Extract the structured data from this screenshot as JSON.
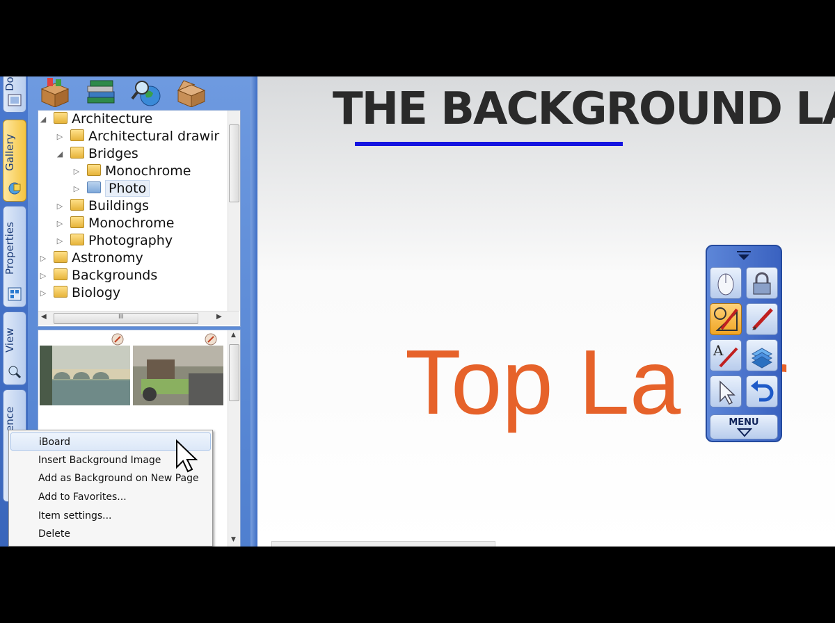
{
  "gallery": {
    "tabs": [
      {
        "label": "Gallery",
        "active": true
      },
      {
        "label": "Properties",
        "active": false
      },
      {
        "label": "View",
        "active": false
      },
      {
        "label": "ence",
        "active": false
      }
    ],
    "top_tab_partial": "Do",
    "toolbar_icons": [
      "open-box-icon",
      "books-icon",
      "globe-search-icon",
      "cardboard-box-icon"
    ],
    "tree": [
      {
        "label": "Architecture",
        "level": 0,
        "expanded": true
      },
      {
        "label": "Architectural drawir",
        "level": 1,
        "expanded": false
      },
      {
        "label": "Bridges",
        "level": 1,
        "expanded": true
      },
      {
        "label": "Monochrome",
        "level": 2,
        "expanded": false
      },
      {
        "label": "Photo",
        "level": 2,
        "expanded": false,
        "selected": true
      },
      {
        "label": "Buildings",
        "level": 1,
        "expanded": false
      },
      {
        "label": "Monochrome",
        "level": 1,
        "expanded": false
      },
      {
        "label": "Photography",
        "level": 1,
        "expanded": false
      },
      {
        "label": "Astronomy",
        "level": 0,
        "expanded": false
      },
      {
        "label": "Backgrounds",
        "level": 0,
        "expanded": false
      },
      {
        "label": "Biology",
        "level": 0,
        "expanded": false
      }
    ],
    "tree_hscroll_grip": "III",
    "thumbnails": [
      "bridge-photo",
      "tractor-photo"
    ]
  },
  "canvas": {
    "heading": "THE BACKGROUND LA",
    "top_layer_text": "Top La er"
  },
  "floating_toolbar": {
    "menu_label": "MENU",
    "buttons": [
      "mouse-icon",
      "lock-icon",
      "shape-pencil-icon",
      "pen-icon",
      "text-pen-icon",
      "3d-shapes-icon",
      "pointer-icon",
      "undo-icon"
    ]
  },
  "context_menu": {
    "items": [
      {
        "label": "iBoard",
        "highlighted": true
      },
      {
        "label": "Insert Background Image"
      },
      {
        "label": "Add as Background on New Page"
      },
      {
        "label": "Add to Favorites..."
      },
      {
        "label": "Item settings..."
      },
      {
        "label": "Delete"
      }
    ]
  },
  "colors": {
    "heading": "#2a2a2a",
    "underline": "#1414e0",
    "top_layer": "#e6622a",
    "panel": "#5a88d8"
  }
}
